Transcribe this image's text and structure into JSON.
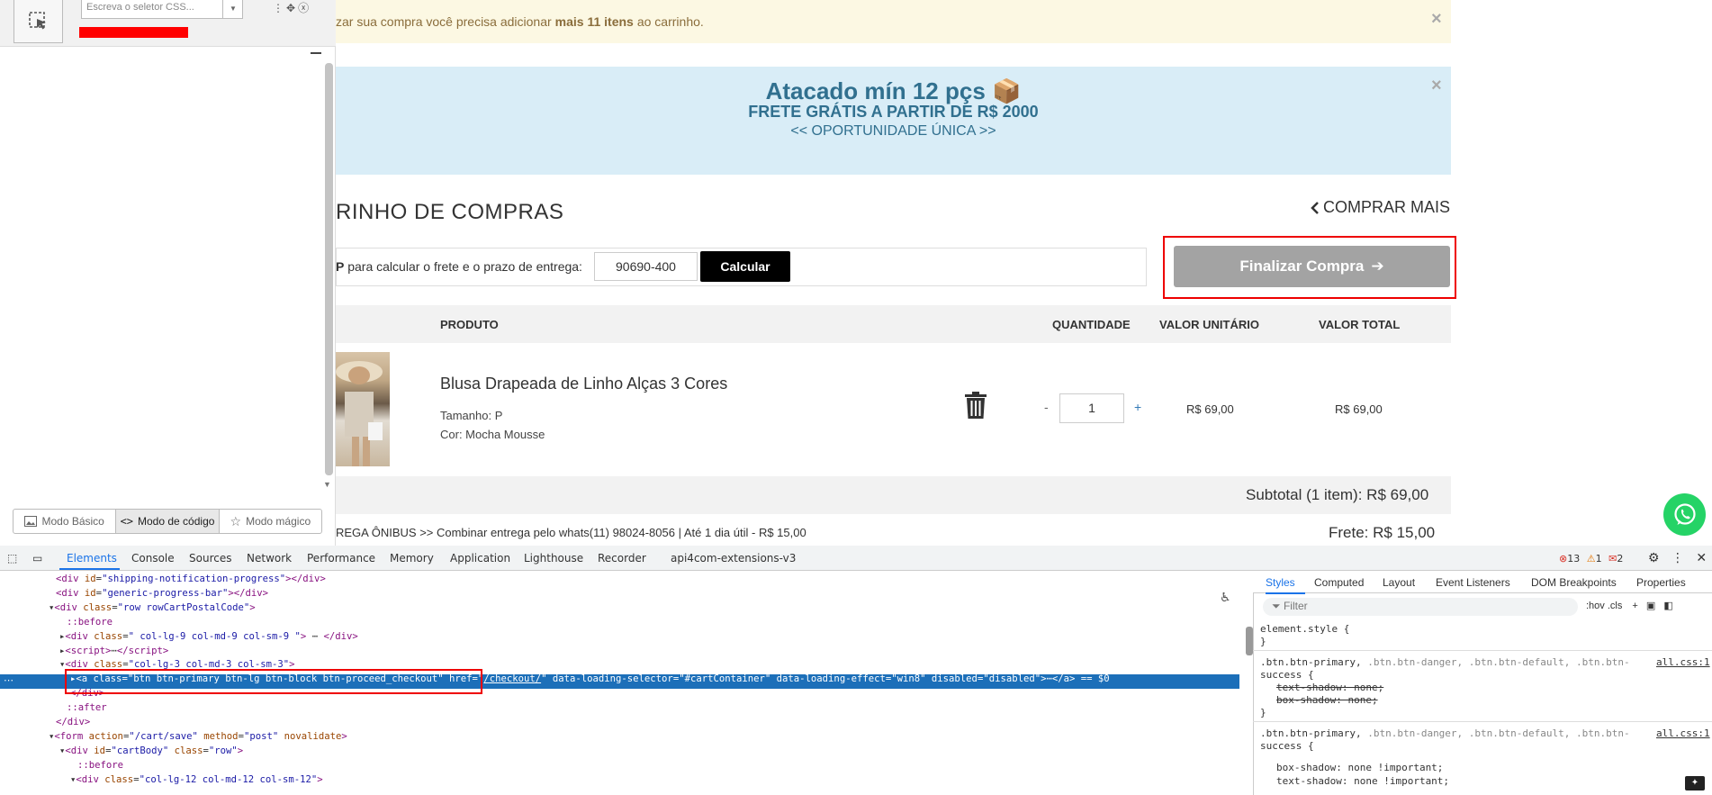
{
  "extension_panel": {
    "selector_placeholder": "Escreva o seletor CSS...",
    "modes": [
      "Modo Básico",
      "Modo de código",
      "Modo mágico"
    ],
    "active_mode": "Modo de código"
  },
  "notice": {
    "text_before": "zar sua compra você precisa adicionar",
    "bold": "mais 11 itens",
    "text_after": "ao carrinho."
  },
  "promo": {
    "title": "Atacado mín 12 pçs 📦",
    "subtitle": "FRETE GRÁTIS A PARTIR DE R$ 2000",
    "link": "<< OPORTUNIDADE ÚNICA >>"
  },
  "cart": {
    "title": "RINHO DE COMPRAS",
    "buy_more": "COMPRAR MAIS",
    "postal_label_bold": "P",
    "postal_label": "para calcular o frete e o prazo de entrega:",
    "postal_value": "90690-400",
    "calc_button": "Calcular",
    "finalize_button": "Finalizar Compra",
    "headers": [
      "PRODUTO",
      "QUANTIDADE",
      "VALOR UNITÁRIO",
      "VALOR TOTAL"
    ],
    "item": {
      "name": "Blusa Drapeada de Linho Alças 3 Cores",
      "size": "Tamanho: P",
      "color": "Cor: Mocha Mousse",
      "qty_minus": "-",
      "qty": "1",
      "qty_plus": "+",
      "unit_price": "R$ 69,00",
      "total_price": "R$ 69,00"
    },
    "subtotal": "Subtotal (1 item): R$ 69,00",
    "shipping_option": "REGA ÔNIBUS >> Combinar entrega pelo whats(11) 98024-8056 | Até 1 dia útil - R$ 15,00",
    "frete": "Frete: R$ 15,00"
  },
  "devtools": {
    "tabs": [
      "Elements",
      "Console",
      "Sources",
      "Network",
      "Performance",
      "Memory",
      "Application",
      "Lighthouse",
      "Recorder",
      "api4com-extensions-v3"
    ],
    "active_tab": "Elements",
    "errors": "13",
    "warnings": "1",
    "issues": "2",
    "dom_lines": [
      {
        "indent": 62,
        "html": "<span class='tag'>&lt;div</span> <span class='an'>id</span>=<span class='av'>\"shipping-notification-progress\"</span><span class='tag'>&gt;&lt;/div&gt;</span>"
      },
      {
        "indent": 62,
        "html": "<span class='tag'>&lt;div</span> <span class='an'>id</span>=<span class='av'>\"generic-progress-bar\"</span><span class='tag'>&gt;&lt;/div&gt;</span>"
      },
      {
        "indent": 54,
        "html": "▾<span class='tag'>&lt;div</span> <span class='an'>class</span>=<span class='av'>\"row rowCartPostalCode\"</span><span class='tag'>&gt;</span>"
      },
      {
        "indent": 74,
        "html": "<span class='pseudo'>::before</span>"
      },
      {
        "indent": 66,
        "html": "▸<span class='tag'>&lt;div</span> <span class='an'>class</span>=<span class='av'>\" col-lg-9 col-md-9 col-sm-9 \"</span><span class='tag'>&gt;</span> ⋯ <span class='tag'>&lt;/div&gt;</span>"
      },
      {
        "indent": 66,
        "html": "▸<span class='tag'>&lt;script&gt;</span>⋯<span class='tag'>&lt;/script&gt;</span>"
      },
      {
        "indent": 66,
        "html": "▾<span class='tag'>&lt;div</span> <span class='an'>class</span>=<span class='av'>\"col-lg-3 col-md-3 col-sm-3\"</span><span class='tag'>&gt;</span>"
      },
      {
        "indent": 78,
        "html": "▸<span class='tag'>&lt;a</span> <span class='an'>class</span>=<span class='av'>\"btn btn-primary btn-lg btn-block btn-proceed_checkout\"</span> <span class='an'>href</span>=<span class='av'>\"<u>/checkout/</u>\"</span> <span class='an'>data-loading-selector</span>=<span class='av'>\"#cartContainer\"</span> <span class='an'>data-loading-effect</span>=<span class='av'>\"win8\"</span> <span class='an'>disabled</span>=<span class='av'>\"disabled\"</span><span class='tag'>&gt;</span>⋯<span class='tag'>&lt;/a&gt;</span> == $0"
      },
      {
        "indent": 78,
        "html": "<span class='tag'>&lt;/div&gt;</span>"
      },
      {
        "indent": 74,
        "html": "<span class='pseudo'>::after</span>"
      },
      {
        "indent": 62,
        "html": "<span class='tag'>&lt;/div&gt;</span>"
      },
      {
        "indent": 54,
        "html": "▾<span class='tag'>&lt;form</span> <span class='an'>action</span>=<span class='av'>\"/cart/save\"</span> <span class='an'>method</span>=<span class='av'>\"post\"</span> <span class='an'>novalidate</span><span class='tag'>&gt;</span>"
      },
      {
        "indent": 66,
        "html": "▾<span class='tag'>&lt;div</span> <span class='an'>id</span>=<span class='av'>\"cartBody\"</span> <span class='an'>class</span>=<span class='av'>\"row\"</span><span class='tag'>&gt;</span>"
      },
      {
        "indent": 86,
        "html": "<span class='pseudo'>::before</span>"
      },
      {
        "indent": 78,
        "html": "▾<span class='tag'>&lt;div</span> <span class='an'>class</span>=<span class='av'>\"col-lg-12 col-md-12 col-sm-12\"</span><span class='tag'>&gt;</span>"
      }
    ],
    "styles_tabs": [
      "Styles",
      "Computed",
      "Layout",
      "Event Listeners",
      "DOM Breakpoints",
      "Properties"
    ],
    "filter_placeholder": "Filter",
    "filter_tools": ":hov .cls",
    "rules": {
      "element_style": "element.style {",
      "close": "}",
      "rule1_selector": ".btn.btn-primary,",
      "rule1_grey": " .btn.btn-danger, .btn.btn-default, .btn.btn-",
      "rule1_grey2": "success {",
      "rule1_p1": "text-shadow: none;",
      "rule1_p2": "box-shadow: none;",
      "rule2_selector": ".btn.btn-primary,",
      "rule2_grey": " .btn.btn-danger, .btn.btn-default, .btn.btn-",
      "rule2_grey2": "success {",
      "rule2_p1": "box-shadow: none !important;",
      "rule2_p2": "text-shadow: none !important;",
      "source": "all.css:1"
    }
  }
}
